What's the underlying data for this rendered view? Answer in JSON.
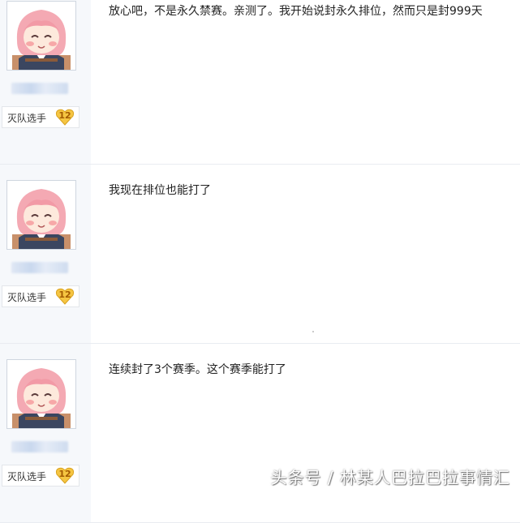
{
  "posts": [
    {
      "badge_title": "灭队选手",
      "level": "12",
      "content": "放心吧，不是永久禁赛。亲测了。我开始说封永久排位，然而只是封999天"
    },
    {
      "badge_title": "灭队选手",
      "level": "12",
      "content": "我现在排位也能打了"
    },
    {
      "badge_title": "灭队选手",
      "level": "12",
      "content": "连续封了3个赛季。这个赛季能打了"
    }
  ],
  "watermark": "头条号 / 林某人巴拉巴拉事情汇",
  "colors": {
    "sidebar_bg": "#f6f8fb",
    "level_badge": "#f5c542",
    "divider": "#e9ecf1"
  },
  "icons": {
    "avatar": "anime-girl-avatar",
    "level": "heart-level-icon"
  }
}
